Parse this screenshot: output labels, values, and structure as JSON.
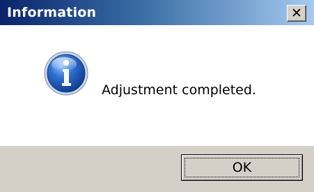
{
  "dialog": {
    "title": "Information",
    "close_glyph": "✕",
    "message": "Adjustment completed.",
    "icon": "information-icon",
    "ok_label": "OK"
  },
  "colors": {
    "titlebar_start": "#0a246a",
    "titlebar_end": "#a6caf0",
    "content_bg": "#ffffff",
    "footer_bg": "#d4d0c8"
  }
}
